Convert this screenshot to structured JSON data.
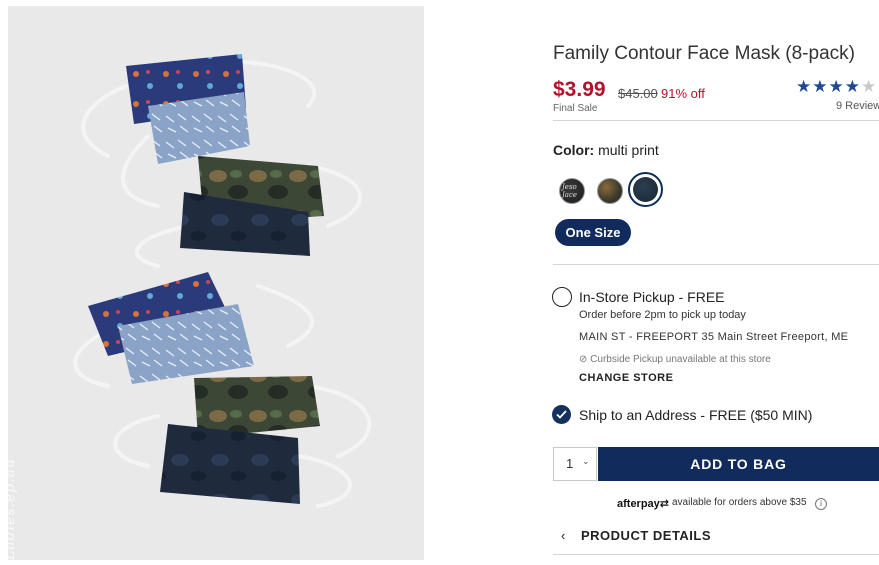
{
  "product": {
    "title": "Family Contour Face Mask (8-pack)",
    "image_alt": "",
    "watermark": "Ladies.ep.au"
  },
  "price": {
    "current": "$3.99",
    "original": "$45.00",
    "discount": "91% off",
    "final_sale": "Final Sale"
  },
  "rating": {
    "stars_filled": "★★★★",
    "stars_empty": "★",
    "value": 3.5,
    "reviews": "9 Review"
  },
  "color": {
    "label": "Color:",
    "value": "multi print",
    "swatch_1_text": "Jeso\nJace",
    "swatches": [
      "print-dark",
      "camo",
      "navy"
    ]
  },
  "size": {
    "selected": "One Size"
  },
  "pickup": {
    "title": "In-Store Pickup - FREE",
    "subtitle": "Order before 2pm to pick up today",
    "store": "MAIN ST - FREEPORT  35 Main Street  Freeport, ME",
    "curbside": "Curbside Pickup unavailable at this store",
    "change_store": "CHANGE STORE"
  },
  "shipping": {
    "label": "Ship to an Address - FREE ($50 MIN)"
  },
  "cart": {
    "quantity": "1",
    "add_to_bag": "ADD TO BAG"
  },
  "afterpay": {
    "logo": "afterpay",
    "text": "available for orders above $35",
    "info_icon": "i"
  },
  "details": {
    "label": "PRODUCT DETAILS",
    "chevron": "‹"
  },
  "colors": {
    "accent_navy": "#112c5c",
    "sale_red": "#b2132b",
    "star_blue": "#1f4a8f"
  }
}
